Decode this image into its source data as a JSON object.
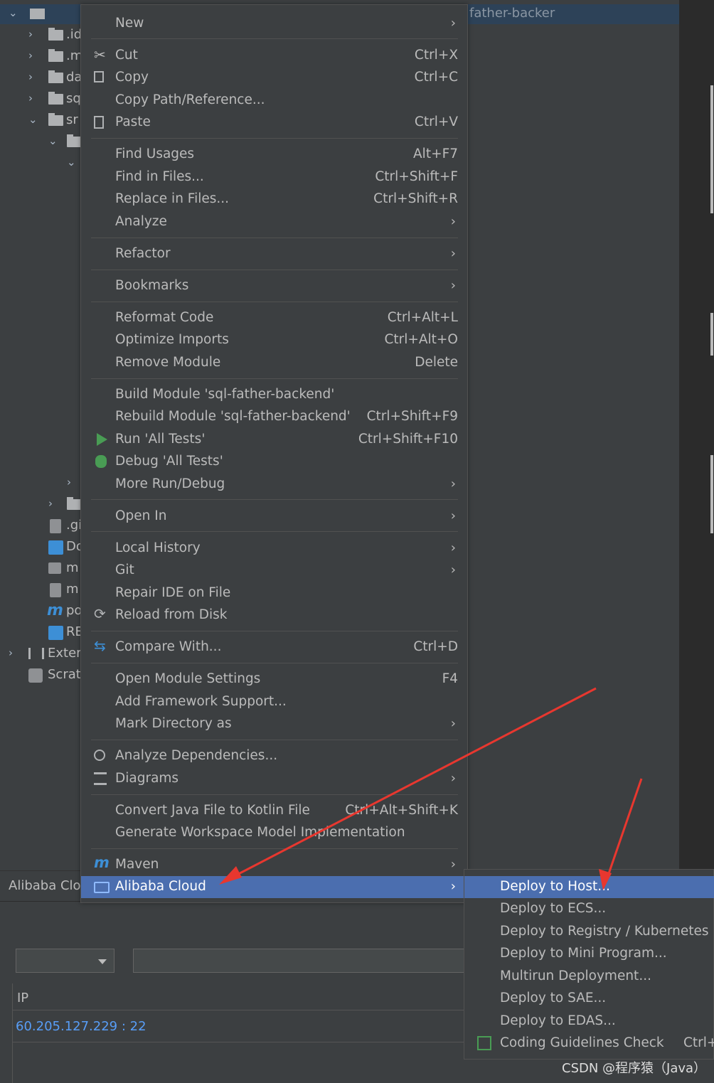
{
  "tree": {
    "rows": [
      {
        "label": ".id"
      },
      {
        "label": ".m"
      },
      {
        "label": "da"
      },
      {
        "label": "sq"
      },
      {
        "label": "sr"
      },
      {
        "label": ".gi"
      },
      {
        "label": "Do"
      },
      {
        "label": "m"
      },
      {
        "label": "m"
      },
      {
        "label": "po"
      },
      {
        "label": "RE"
      },
      {
        "label": "Extern"
      },
      {
        "label": "Scratc"
      }
    ],
    "header_fragment": "father-backer"
  },
  "menu": {
    "new": "New",
    "cut": "Cut",
    "cut_sc": "Ctrl+X",
    "copy": "Copy",
    "copy_sc": "Ctrl+C",
    "copy_path": "Copy Path/Reference...",
    "paste": "Paste",
    "paste_sc": "Ctrl+V",
    "find_usages": "Find Usages",
    "find_usages_sc": "Alt+F7",
    "find_in_files": "Find in Files...",
    "find_in_files_sc": "Ctrl+Shift+F",
    "replace_in_files": "Replace in Files...",
    "replace_in_files_sc": "Ctrl+Shift+R",
    "analyze": "Analyze",
    "refactor": "Refactor",
    "bookmarks": "Bookmarks",
    "reformat": "Reformat Code",
    "reformat_sc": "Ctrl+Alt+L",
    "optimize": "Optimize Imports",
    "optimize_sc": "Ctrl+Alt+O",
    "remove_module": "Remove Module",
    "remove_module_sc": "Delete",
    "build_module": "Build Module 'sql-father-backend'",
    "rebuild_module": "Rebuild Module 'sql-father-backend'",
    "rebuild_module_sc": "Ctrl+Shift+F9",
    "run_tests": "Run 'All Tests'",
    "run_tests_sc": "Ctrl+Shift+F10",
    "debug_tests": "Debug 'All Tests'",
    "more_run": "More Run/Debug",
    "open_in": "Open In",
    "local_history": "Local History",
    "git": "Git",
    "repair_ide": "Repair IDE on File",
    "reload_disk": "Reload from Disk",
    "compare_with": "Compare With...",
    "compare_with_sc": "Ctrl+D",
    "module_settings": "Open Module Settings",
    "module_settings_sc": "F4",
    "framework_support": "Add Framework Support...",
    "mark_directory": "Mark Directory as",
    "analyze_deps": "Analyze Dependencies...",
    "diagrams": "Diagrams",
    "convert_kotlin": "Convert Java File to Kotlin File",
    "convert_kotlin_sc": "Ctrl+Alt+Shift+K",
    "gen_workspace": "Generate Workspace Model Implementation",
    "maven": "Maven",
    "alibaba_cloud": "Alibaba Cloud"
  },
  "submenu": {
    "deploy_host": "Deploy to Host...",
    "deploy_ecs": "Deploy to ECS...",
    "deploy_registry": "Deploy to Registry / Kubernetes",
    "deploy_mini": "Deploy to Mini Program...",
    "multirun": "Multirun Deployment...",
    "deploy_sae": "Deploy to SAE...",
    "deploy_edas": "Deploy to EDAS...",
    "coding_guidelines": "Coding Guidelines Check",
    "coding_guidelines_sc": "Ctrl+"
  },
  "tool_window": {
    "title": "Alibaba Clo",
    "column_ip": "IP",
    "host": "60.205.127.229 : 22"
  },
  "watermark": "CSDN @程序猿（Java）",
  "colors": {
    "selection": "#4b6eaf",
    "arrow": "#e8372f",
    "link": "#589df6"
  }
}
